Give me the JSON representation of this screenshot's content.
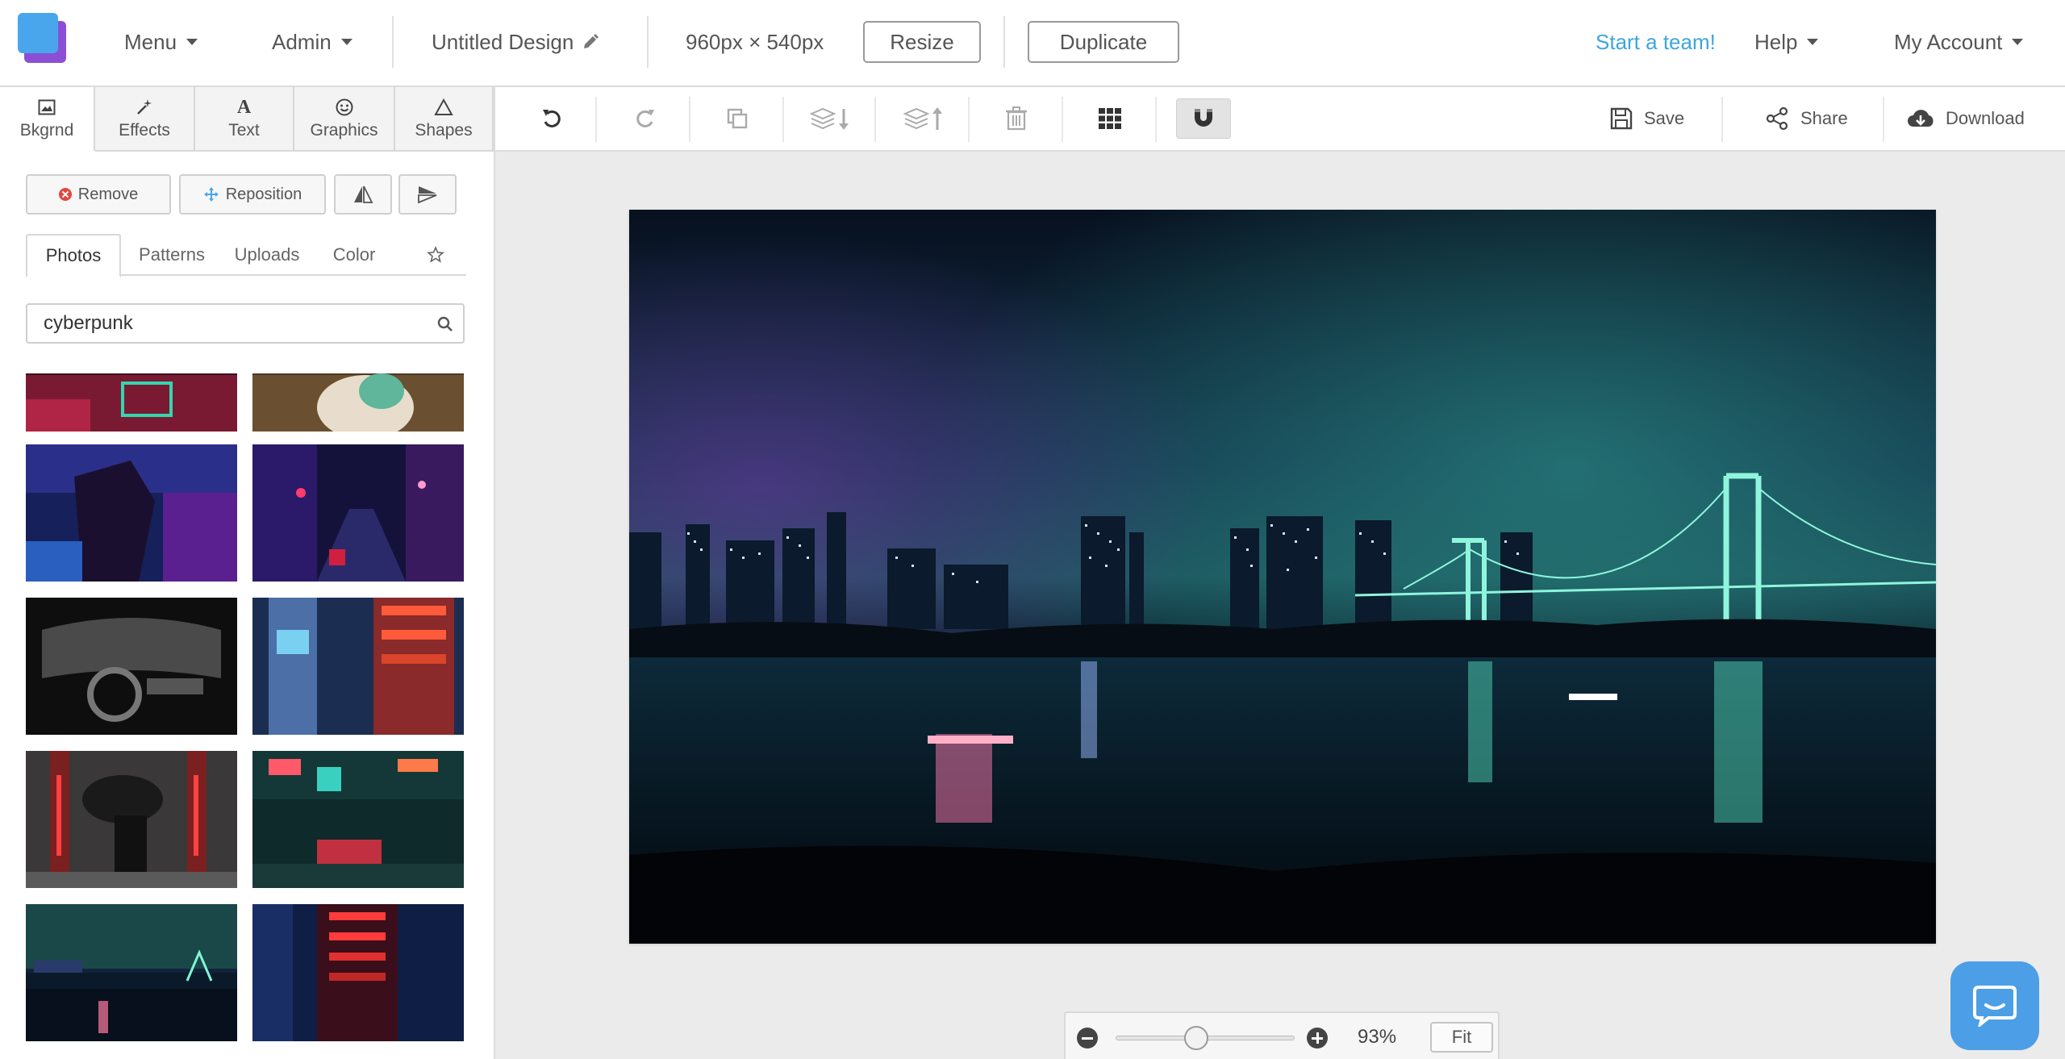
{
  "header": {
    "menu_label": "Menu",
    "admin_label": "Admin",
    "design_title": "Untitled Design",
    "dimensions": "960px × 540px",
    "resize_label": "Resize",
    "duplicate_label": "Duplicate",
    "start_team_label": "Start a team!",
    "help_label": "Help",
    "account_label": "My Account"
  },
  "left_tabs": [
    {
      "label": "Bkgrnd",
      "icon": "image-icon"
    },
    {
      "label": "Effects",
      "icon": "magic-wand-icon"
    },
    {
      "label": "Text",
      "icon": "text-a-icon"
    },
    {
      "label": "Graphics",
      "icon": "smiley-icon"
    },
    {
      "label": "Shapes",
      "icon": "triangle-icon"
    }
  ],
  "background_actions": {
    "remove_label": "Remove",
    "reposition_label": "Reposition"
  },
  "source_tabs": {
    "photos": "Photos",
    "patterns": "Patterns",
    "uploads": "Uploads",
    "color": "Color"
  },
  "search": {
    "value": "cyberpunk"
  },
  "thumbnails": [
    "neon-sign-red",
    "figure-green-jacket",
    "person-neon-room",
    "neon-city-street",
    "car-interior-night",
    "neon-alley-signs",
    "couple-smoke-alley",
    "neon-street-taxi",
    "night-city-bridge",
    "red-neon-tower"
  ],
  "toolbar": {
    "save_label": "Save",
    "share_label": "Share",
    "download_label": "Download"
  },
  "zoom": {
    "percent_label": "93%",
    "level": 0.45,
    "fit_label": "Fit"
  },
  "colors": {
    "accent_link": "#3ea6dc",
    "logo_blue": "#4aa6ec",
    "logo_purple": "#8b4fd6",
    "chat_button": "#4c9fe6"
  }
}
